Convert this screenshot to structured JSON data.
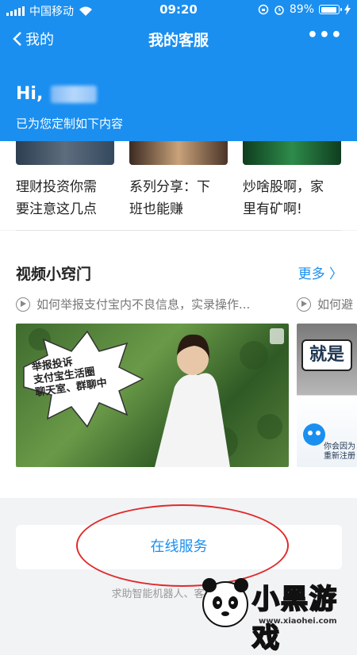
{
  "status_bar": {
    "carrier": "中国移动",
    "time": "09:20",
    "battery": "89%"
  },
  "nav": {
    "back_label": "我的",
    "title": "我的客服",
    "more_label": "•••"
  },
  "greeting": {
    "hi": "Hi,",
    "subtitle": "已为您定制如下内容"
  },
  "articles": [
    {
      "line1": "理财投资你需",
      "line2": "要注意这几点"
    },
    {
      "line1": "系列分享：下",
      "line2": "班也能赚"
    },
    {
      "line1": "炒啥股啊，家",
      "line2": "里有矿啊!"
    }
  ],
  "video_section": {
    "title": "视频小窍门",
    "more_label": "更多 〉",
    "videos": [
      {
        "caption": "如何举报支付宝内不良信息，实录操作..."
      },
      {
        "caption": "如何避"
      }
    ],
    "thumb_text": {
      "line1": "举报投诉",
      "line2": "支付宝生活圈",
      "line3": "聊天室、群聊中",
      "side1": "就是",
      "side2": "你会因为",
      "side3": "重新注册"
    }
  },
  "online_service": {
    "label": "在线服务",
    "desc": "求助智能机器人、客服小二，"
  },
  "watermark": {
    "text": "小黑游戏",
    "url": "www.xiaohei.com"
  },
  "colors": {
    "brand": "#1a8ff0",
    "highlight": "#e02a2a"
  }
}
